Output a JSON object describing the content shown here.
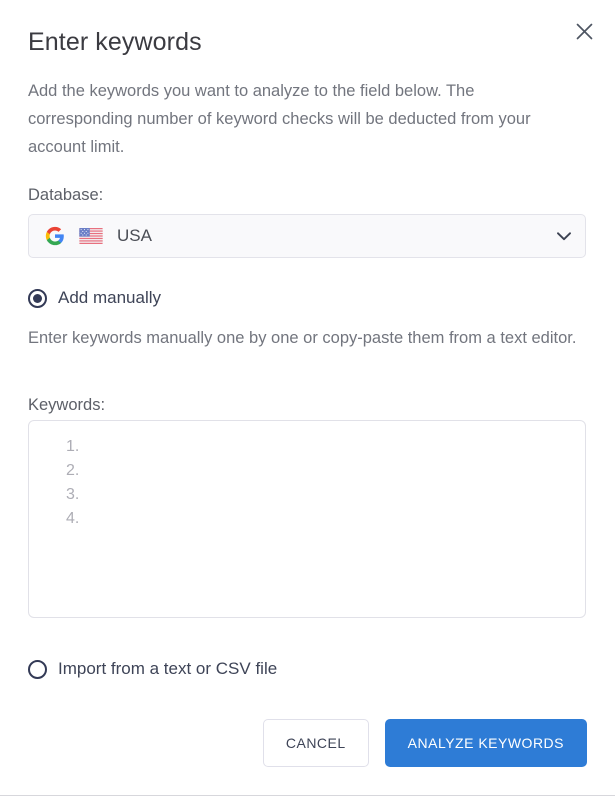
{
  "dialog": {
    "title": "Enter keywords",
    "description": "Add the keywords you want to analyze to the field below. The corresponding number of keyword checks will be deducted from your account limit.",
    "close_icon": "close-icon"
  },
  "database": {
    "label": "Database:",
    "engine_icon": "google-logo-icon",
    "country_flag_icon": "usa-flag-icon",
    "value": "USA",
    "chevron_icon": "chevron-down-icon"
  },
  "source_options": [
    {
      "id": "add-manually",
      "label": "Add manually",
      "selected": true,
      "hint": "Enter keywords manually one by one or copy-paste them from a text editor."
    },
    {
      "id": "import-file",
      "label": "Import from a text or CSV file",
      "selected": false
    }
  ],
  "keywords": {
    "label": "Keywords:",
    "value": "",
    "placeholder_lines": [
      "1.",
      "2.",
      "3.",
      "4."
    ]
  },
  "footer": {
    "cancel_label": "CANCEL",
    "submit_label": "ANALYZE KEYWORDS"
  },
  "colors": {
    "primary": "#2e7cd6",
    "radio": "#333a56",
    "title_text": "#3b3b41",
    "body_text": "#72757e",
    "border": "#e1e1e8"
  }
}
